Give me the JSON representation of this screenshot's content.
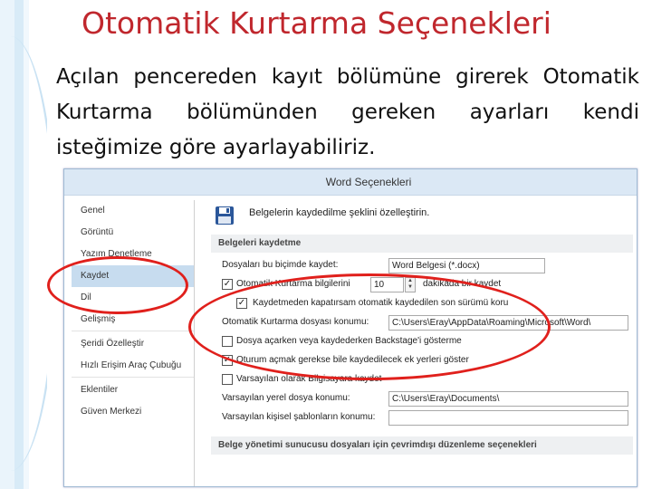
{
  "slide": {
    "title": "Otomatik Kurtarma Seçenekleri",
    "body": "Açılan pencereden kayıt bölümüne girerek Otomatik Kurtarma bölümünden gereken ayarları kendi isteğimize göre ayarlayabiliriz."
  },
  "dialog": {
    "title": "Word Seçenekleri",
    "nav": [
      "Genel",
      "Görüntü",
      "Yazım Denetleme",
      "Kaydet",
      "Dil",
      "Gelişmiş",
      "Şeridi Özelleştir",
      "Hızlı Erişim Araç Çubuğu",
      "Eklentiler",
      "Güven Merkezi"
    ],
    "selected_nav": "Kaydet",
    "header_text": "Belgelerin kaydedilme şeklini özelleştirin.",
    "section_save": "Belgeleri kaydetme",
    "format_label": "Dosyaları bu biçimde kaydet:",
    "format_value": "Word Belgesi (*.docx)",
    "autorecover_label": "Otomatik Kurtarma bilgilerini",
    "autorecover_minutes": "10",
    "autorecover_suffix": "dakikada bir kaydet",
    "keep_last_label": "Kaydetmeden kapatırsam otomatik kaydedilen son sürümü koru",
    "autorecover_location_label": "Otomatik Kurtarma dosyası konumu:",
    "autorecover_location_value": "C:\\Users\\Eray\\AppData\\Roaming\\Microsoft\\Word\\",
    "backstage_label": "Dosya açarken veya kaydederken Backstage'i gösterme",
    "extra_places_label": "Oturum açmak gerekse bile kaydedilecek ek yerleri göster",
    "default_computer_label": "Varsayılan olarak Bilgisayara kaydet",
    "local_location_label": "Varsayılan yerel dosya konumu:",
    "local_location_value": "C:\\Users\\Eray\\Documents\\",
    "templates_label": "Varsayılan kişisel şablonların konumu:",
    "templates_value": "",
    "section_server": "Belge yönetimi sunucusu dosyaları için çevrimdışı düzenleme seçenekleri",
    "checked": {
      "autorecover": true,
      "keep_last": true,
      "backstage": false,
      "extra_places": true,
      "default_computer": false
    }
  },
  "colors": {
    "title": "#c0272d",
    "annotation": "#e0201c",
    "nav_selected": "#c7dcef"
  }
}
